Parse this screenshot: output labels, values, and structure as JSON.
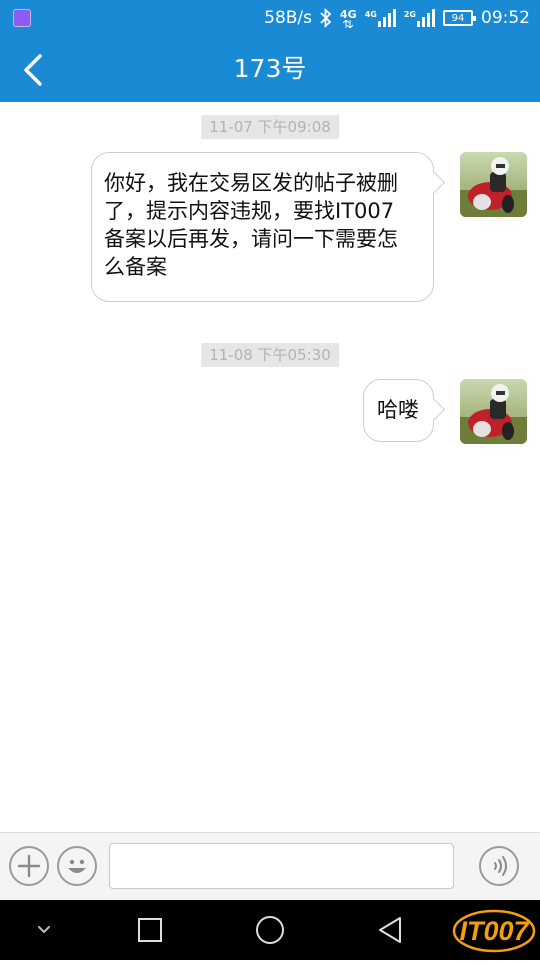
{
  "status_bar": {
    "network_speed": "58B/s",
    "network_4g": "4G",
    "network_4g_small": "4G",
    "network_2g": "2G",
    "battery": "94",
    "time": "09:52"
  },
  "header": {
    "title": "173号"
  },
  "messages": [
    {
      "timestamp": "11-07 下午09:08",
      "text": [
        "你好，我在交易区发的帖子被删",
        "了，提示内容违规，要找IT007",
        "备案以后再发，请问一下需要怎",
        "么备案"
      ]
    },
    {
      "timestamp": "11-08 下午05:30",
      "text": "哈喽"
    }
  ],
  "input_bar": {
    "message_value": ""
  },
  "watermark": {
    "logo_text": "IT007"
  },
  "colors": {
    "accent": "#1a8ad4",
    "timestamp_bg": "#e6e6e6",
    "nav_bg": "#000000"
  }
}
